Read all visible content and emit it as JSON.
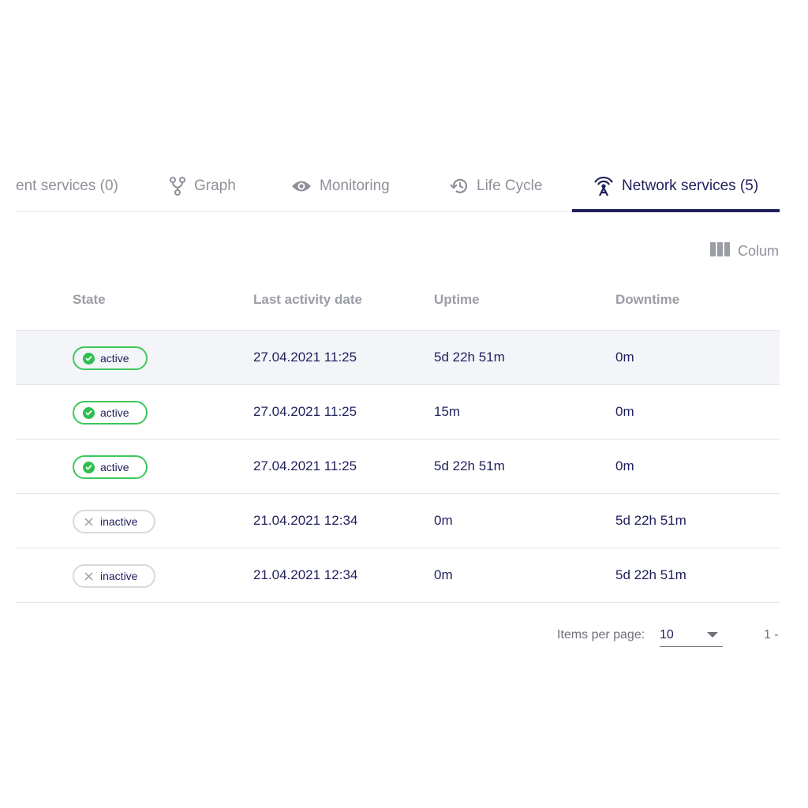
{
  "tabs": [
    {
      "label": "ent services (0)",
      "icon": "dependent-services-icon",
      "active": false
    },
    {
      "label": "Graph",
      "icon": "graph-icon",
      "active": false
    },
    {
      "label": "Monitoring",
      "icon": "eye-icon",
      "active": false
    },
    {
      "label": "Life Cycle",
      "icon": "history-icon",
      "active": false
    },
    {
      "label": "Network services (5)",
      "icon": "antenna-icon",
      "active": true
    }
  ],
  "toolbar": {
    "columns_label": "Colum",
    "columns_icon": "columns-icon"
  },
  "table": {
    "headers": {
      "state": "State",
      "last_activity": "Last activity date",
      "uptime": "Uptime",
      "downtime": "Downtime"
    },
    "rows": [
      {
        "state": "active",
        "date": "27.04.2021 11:25",
        "uptime": "5d 22h 51m",
        "downtime": "0m"
      },
      {
        "state": "active",
        "date": "27.04.2021 11:25",
        "uptime": "15m",
        "downtime": "0m"
      },
      {
        "state": "active",
        "date": "27.04.2021 11:25",
        "uptime": "5d 22h 51m",
        "downtime": "0m"
      },
      {
        "state": "inactive",
        "date": "21.04.2021 12:34",
        "uptime": "0m",
        "downtime": "5d 22h 51m"
      },
      {
        "state": "inactive",
        "date": "21.04.2021 12:34",
        "uptime": "0m",
        "downtime": "5d 22h 51m"
      }
    ]
  },
  "paginator": {
    "items_per_page_label": "Items per page:",
    "page_size": "10",
    "range_label": "1 -"
  },
  "colors": {
    "accent": "#1f1f5c",
    "active_green": "#3cc85a",
    "muted": "#8e9099",
    "row_highlight": "#f3f5f8"
  }
}
